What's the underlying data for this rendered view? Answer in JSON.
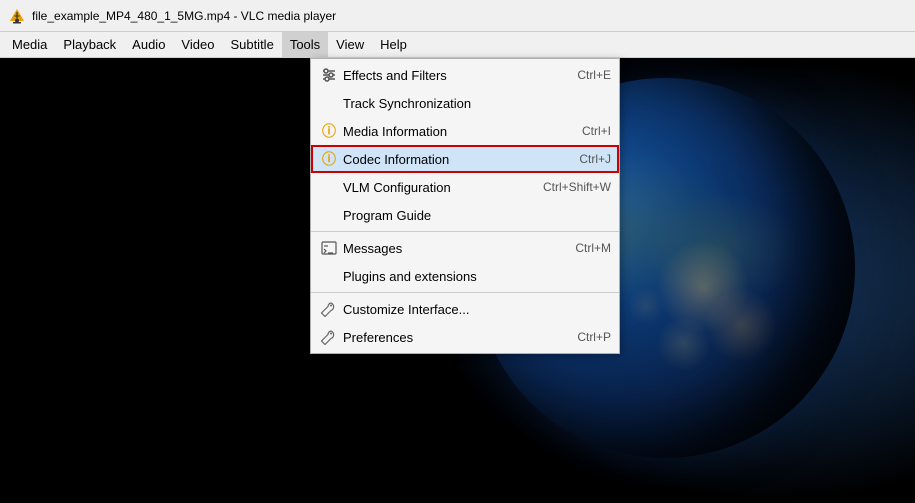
{
  "titleBar": {
    "text": "file_example_MP4_480_1_5MG.mp4 - VLC media player"
  },
  "menuBar": {
    "items": [
      {
        "id": "media",
        "label": "Media",
        "active": false
      },
      {
        "id": "playback",
        "label": "Playback",
        "active": false
      },
      {
        "id": "audio",
        "label": "Audio",
        "active": false
      },
      {
        "id": "video",
        "label": "Video",
        "active": false
      },
      {
        "id": "subtitle",
        "label": "Subtitle",
        "active": false
      },
      {
        "id": "tools",
        "label": "Tools",
        "active": true
      },
      {
        "id": "view",
        "label": "View",
        "active": false
      },
      {
        "id": "help",
        "label": "Help",
        "active": false
      }
    ]
  },
  "toolsMenu": {
    "items": [
      {
        "id": "effects-filters",
        "icon": "sliders",
        "iconChar": "⚙",
        "label": "Effects and Filters",
        "shortcut": "Ctrl+E",
        "highlighted": false,
        "hasIcon": true,
        "iconType": "sliders"
      },
      {
        "id": "track-sync",
        "icon": null,
        "label": "Track Synchronization",
        "shortcut": "",
        "highlighted": false,
        "hasIcon": false
      },
      {
        "id": "media-info",
        "icon": "info",
        "iconChar": "ℹ",
        "label": "Media Information",
        "shortcut": "Ctrl+I",
        "highlighted": false,
        "hasIcon": true,
        "iconType": "info"
      },
      {
        "id": "codec-info",
        "icon": "info",
        "iconChar": "ℹ",
        "label": "Codec Information",
        "shortcut": "Ctrl+J",
        "highlighted": true,
        "hasIcon": true,
        "iconType": "info"
      },
      {
        "id": "vlm-config",
        "icon": null,
        "label": "VLM Configuration",
        "shortcut": "Ctrl+Shift+W",
        "highlighted": false,
        "hasIcon": false
      },
      {
        "id": "program-guide",
        "icon": null,
        "label": "Program Guide",
        "shortcut": "",
        "highlighted": false,
        "hasIcon": false
      },
      {
        "id": "separator1",
        "type": "separator"
      },
      {
        "id": "messages",
        "icon": "terminal",
        "iconChar": "▤",
        "label": "Messages",
        "shortcut": "Ctrl+M",
        "highlighted": false,
        "hasIcon": true,
        "iconType": "terminal"
      },
      {
        "id": "plugins",
        "icon": null,
        "label": "Plugins and extensions",
        "shortcut": "",
        "highlighted": false,
        "hasIcon": false
      },
      {
        "id": "separator2",
        "type": "separator"
      },
      {
        "id": "customize",
        "icon": "wrench",
        "iconChar": "🔧",
        "label": "Customize Interface...",
        "shortcut": "",
        "highlighted": false,
        "hasIcon": true,
        "iconType": "wrench"
      },
      {
        "id": "preferences",
        "icon": "wrench",
        "iconChar": "🔧",
        "label": "Preferences",
        "shortcut": "Ctrl+P",
        "highlighted": false,
        "hasIcon": true,
        "iconType": "wrench"
      }
    ]
  }
}
